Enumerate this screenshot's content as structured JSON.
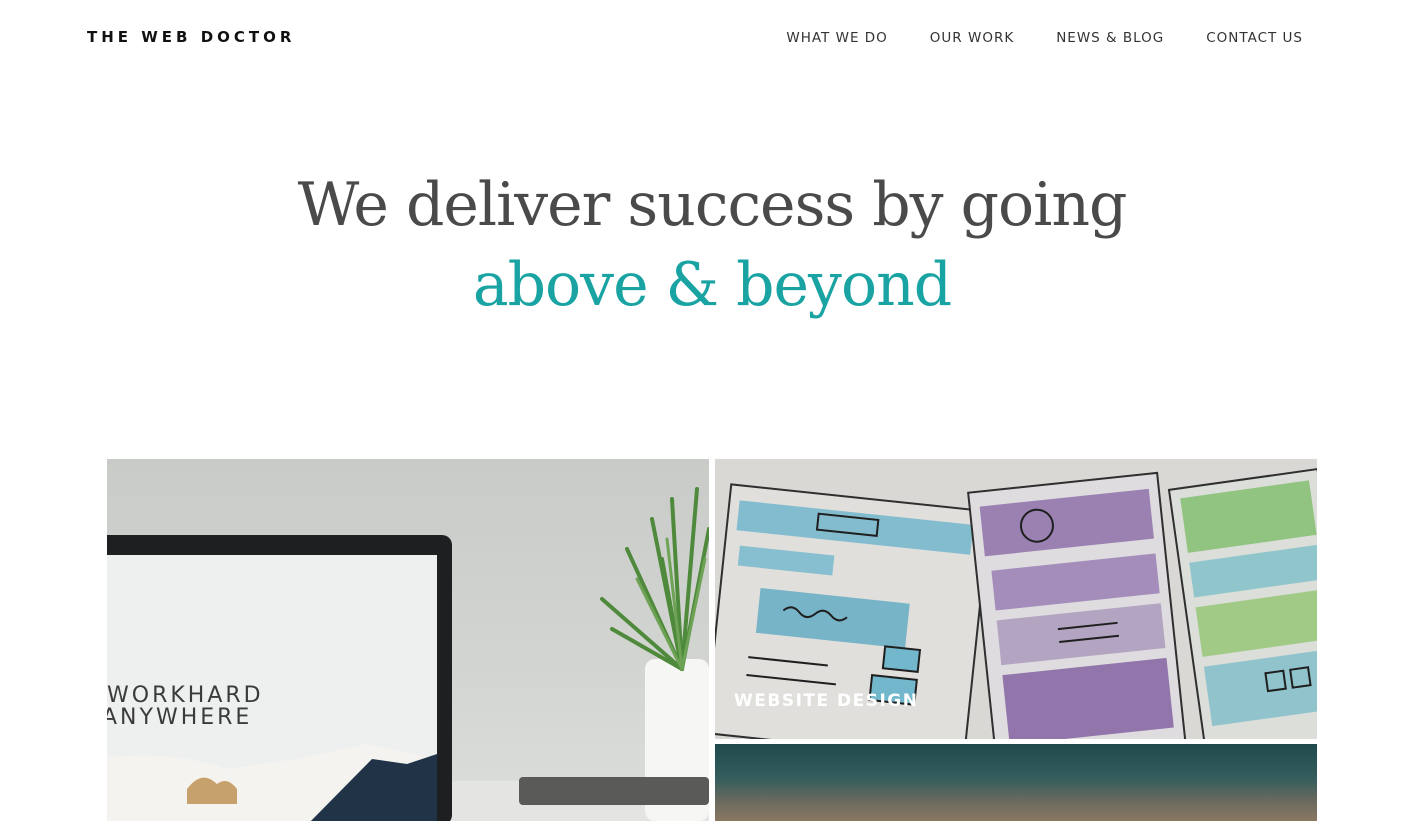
{
  "header": {
    "logo": "THE WEB DOCTOR",
    "nav": [
      {
        "label": "WHAT WE DO"
      },
      {
        "label": "OUR WORK"
      },
      {
        "label": "NEWS & BLOG"
      },
      {
        "label": "CONTACT US"
      }
    ]
  },
  "hero": {
    "line1": "We deliver success by going",
    "line2": "above & beyond",
    "accent_color": "#1aa3a3"
  },
  "tiles": {
    "left": {
      "image_text_line1": "WORKHARD",
      "image_text_line2": "ANYWHERE"
    },
    "right_top": {
      "label": "WEBSITE DESIGN"
    },
    "right_bottom": {}
  }
}
